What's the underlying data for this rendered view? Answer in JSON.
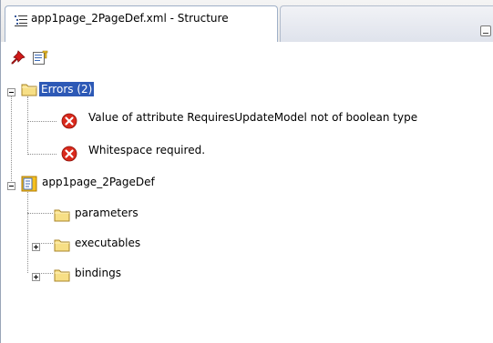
{
  "tab": {
    "title": "app1page_2PageDef.xml - Structure"
  },
  "toolbar": {
    "pin_icon": "pin-icon",
    "edit_icon": "edit-properties-icon"
  },
  "tree": {
    "errors": {
      "label": "Errors (2)",
      "items": [
        "Value of attribute RequiresUpdateModel not of boolean type",
        "Whitespace required."
      ]
    },
    "pagedef": {
      "label": "app1page_2PageDef",
      "children": [
        "parameters",
        "executables",
        "bindings"
      ]
    }
  },
  "colors": {
    "selection": "#2d59b6",
    "error_red": "#d9291c",
    "folder_yellow": "#f5d76a"
  }
}
